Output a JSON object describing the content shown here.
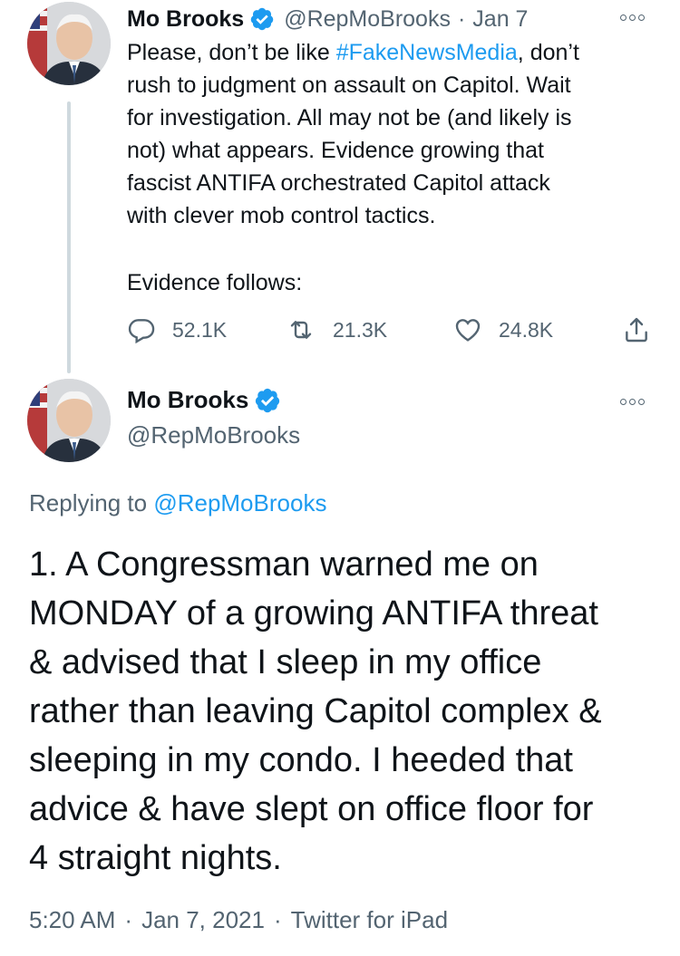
{
  "tweet1": {
    "name": "Mo Brooks",
    "handle": "@RepMoBrooks",
    "separator": "·",
    "date": "Jan 7",
    "text_lines": [
      {
        "before": "Please, don’t be like ",
        "hashtag": "#FakeNewsMedia",
        "after": ", don’t"
      },
      "rush to judgment on assault on Capitol. Wait",
      "for investigation. All may not be (and likely is",
      "not) what appears. Evidence growing that",
      "fascist ANTIFA orchestrated Capitol attack",
      "with clever mob control tactics."
    ],
    "evidence_line": "Evidence follows:",
    "actions": {
      "replies": "52.1K",
      "retweets": "21.3K",
      "likes": "24.8K"
    }
  },
  "tweet2": {
    "name": "Mo Brooks",
    "handle": "@RepMoBrooks",
    "replying_label": "Replying to ",
    "replying_to": "@RepMoBrooks",
    "text_lines": [
      "1. A Congressman warned me on",
      "MONDAY of a growing ANTIFA threat",
      "& advised that I sleep in my office",
      "rather than leaving Capitol complex &",
      "sleeping in my condo. I heeded that",
      "advice & have slept on office floor for",
      "4 straight nights."
    ],
    "time": "5:20 AM",
    "full_date": "Jan 7, 2021",
    "source": "Twitter for iPad",
    "separator": "·"
  },
  "colors": {
    "accent": "#1d9bf0",
    "text": "#0f1419",
    "secondary": "#536471",
    "thread_line": "#cfd9de"
  },
  "icons": [
    "verified-badge-icon",
    "more-options-icon",
    "reply-icon",
    "retweet-icon",
    "like-icon",
    "share-icon"
  ]
}
